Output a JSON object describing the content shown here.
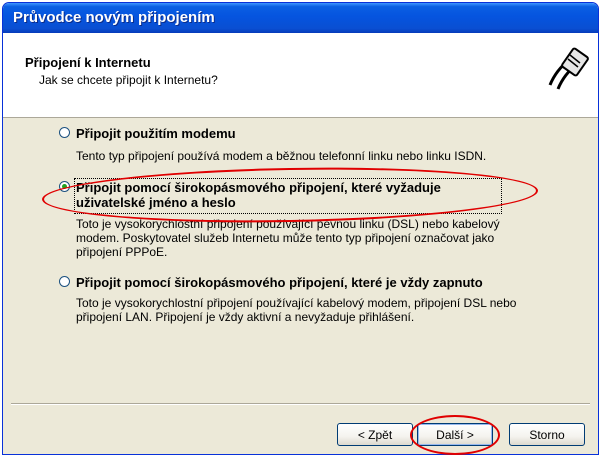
{
  "window": {
    "title": "Průvodce novým připojením"
  },
  "header": {
    "title": "Připojení k Internetu",
    "subtitle": "Jak se chcete připojit k Internetu?",
    "icon": "network-cable-icon"
  },
  "options": [
    {
      "label": "Připojit použitím modemu",
      "description": "Tento typ připojení používá modem a běžnou telefonní linku nebo linku ISDN.",
      "selected": false
    },
    {
      "label_line1": "Připojit pomocí širokopásmového připojení, které vyžaduje",
      "label_line2": "uživatelské jméno a heslo",
      "description": "Toto je vysokorychlostní připojení používající pevnou linku (DSL) nebo kabelový modem. Poskytovatel služeb Internetu může tento typ připojení označovat jako připojení PPPoE.",
      "selected": true
    },
    {
      "label": "Připojit pomocí širokopásmového připojení, které je vždy zapnuto",
      "description": "Toto je vysokorychlostní připojení používající kabelový modem, připojení DSL nebo připojení LAN. Připojení je vždy aktivní a nevyžaduje přihlášení.",
      "selected": false
    }
  ],
  "buttons": {
    "back": "< Zpět",
    "next": "Další >",
    "cancel": "Storno"
  },
  "colors": {
    "annotation": "#e00000",
    "titlebar": "#0554df",
    "dialog_bg": "#ece9d8"
  }
}
